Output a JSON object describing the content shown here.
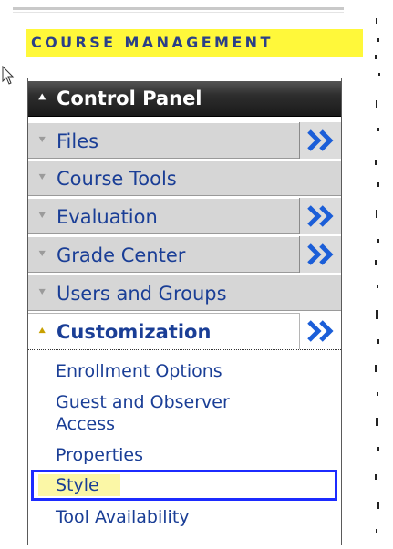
{
  "header": {
    "course_management": "COURSE MANAGEMENT"
  },
  "control_panel": {
    "title": "Control Panel",
    "items": [
      {
        "label": "Files",
        "has_expand": true
      },
      {
        "label": "Course Tools",
        "has_expand": false
      },
      {
        "label": "Evaluation",
        "has_expand": true
      },
      {
        "label": "Grade Center",
        "has_expand": true
      },
      {
        "label": "Users and Groups",
        "has_expand": false
      },
      {
        "label": "Customization",
        "has_expand": true,
        "active": true
      }
    ],
    "sub_items": [
      "Enrollment Options",
      "Guest and Observer",
      "Access",
      "Properties",
      "Style",
      "Tool Availability"
    ],
    "highlighted_sub_item": "Style"
  },
  "colors": {
    "link": "#1a3e96",
    "header_bg": "#2e2e2e",
    "highlight_yellow": "#fff83a",
    "selection_border": "#1c2bff",
    "expand_arrow": "#1b5ed8"
  },
  "icons": {
    "collapsed_chevron": "double-chevron-down-icon",
    "expanded_chevron": "double-chevron-up-icon",
    "expand_button": "double-chevron-right-icon",
    "cursor": "mouse-pointer-icon"
  }
}
